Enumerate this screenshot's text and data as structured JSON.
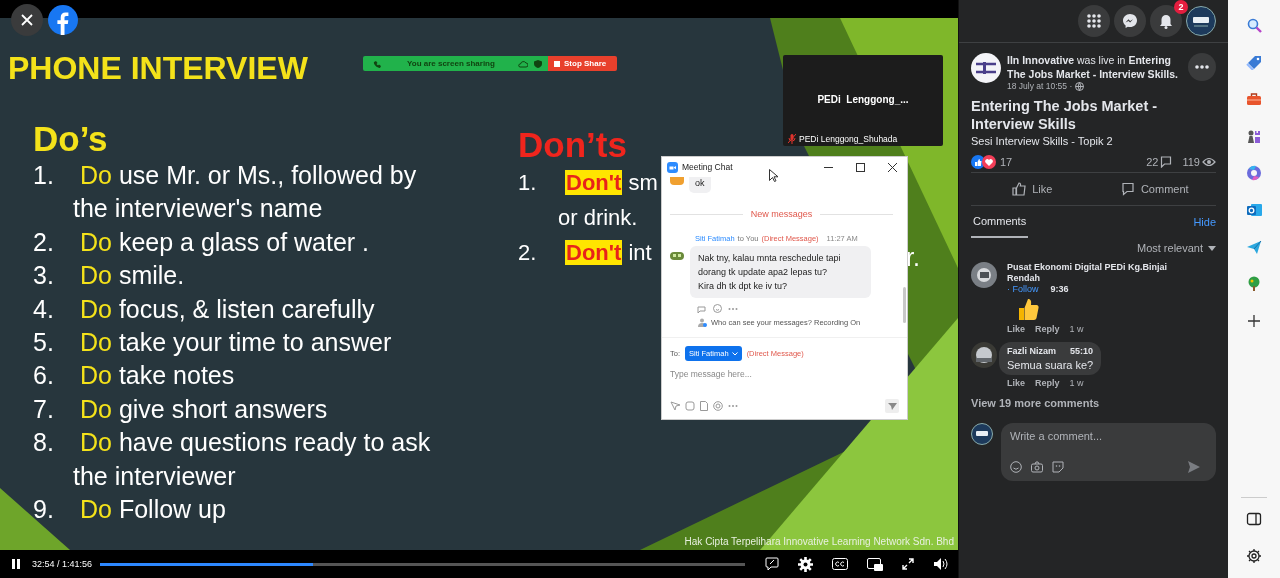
{
  "player": {
    "playing": true,
    "time": "32:54 / 1:41:56",
    "level": 0.33
  },
  "slide": {
    "title": "PHONE INTERVIEW",
    "dos": {
      "heading": "Do’s",
      "items": [
        {
          "number": "1.",
          "keyword": "Do",
          "lines": [
            "use Mr. or Ms., followed by",
            "the interviewer's name"
          ]
        },
        {
          "number": "2.",
          "keyword": "Do",
          "lines": [
            "keep a glass of water ."
          ]
        },
        {
          "number": "3.",
          "keyword": "Do",
          "lines": [
            "smile."
          ]
        },
        {
          "number": "4.",
          "keyword": "Do",
          "lines": [
            "focus, & listen carefully"
          ]
        },
        {
          "number": "5.",
          "keyword": "Do",
          "lines": [
            "take your time to answer"
          ]
        },
        {
          "number": "6.",
          "keyword": "Do",
          "lines": [
            "take notes"
          ]
        },
        {
          "number": "7.",
          "keyword": "Do",
          "lines": [
            "give short answers"
          ]
        },
        {
          "number": "8.",
          "keyword": "Do",
          "lines": [
            "have questions ready to ask",
            "the interviewer"
          ]
        },
        {
          "number": "9.",
          "keyword": "Do",
          "lines": [
            "Follow up"
          ]
        }
      ]
    },
    "donts": {
      "heading": "Don’ts",
      "items": [
        {
          "number": "1.",
          "keyword": "Don't",
          "lines": [
            "sm",
            "or drink."
          ]
        },
        {
          "number": "2.",
          "keyword": "Don't",
          "lines": [
            "int"
          ]
        }
      ],
      "fragment": "r."
    },
    "footer": "Hak Cipta Terpelihara Innovative Learning Network Sdn. Bhd"
  },
  "share_bar": {
    "status": "You are screen sharing",
    "stop_label": "Stop Share"
  },
  "participant": {
    "name": "PEDi  Lenggong_...",
    "label": "PEDi Lenggong_Shuhada",
    "muted": true
  },
  "chat": {
    "title": "Meeting Chat",
    "previous": "ok",
    "divider": "New messages",
    "message": {
      "sender": "Siti Fatimah",
      "to": "to You",
      "type": "(Direct Message)",
      "time": "11:27 AM",
      "lines": [
        "Nak tny, kalau mnta reschedule tapi",
        "dorang tk update apa2 lepas tu?",
        "Kira dh tk dpt ke iv tu?"
      ]
    },
    "notice": "Who can see your messages? Recording On",
    "to_label": "To:",
    "recipient": "Siti Fatimah",
    "recipient_note": "(Direct Message)",
    "input": {
      "placeholder": "Type message here..."
    }
  },
  "facebook": {
    "notifications": "2",
    "post": {
      "header": "**Iln Innovative** was live in **Entering The Jobs Market - Interview Skills.**",
      "date": "18 July at 10:55 ·",
      "title": "Entering The Jobs Market - Interview Skills",
      "subtitle": "Sesi Interview Skills - Topik 2",
      "reactions": "17",
      "comments": "22",
      "views": "119"
    },
    "actions": [
      "Like",
      "Comment"
    ],
    "tabs": [
      {
        "label": "Comments",
        "selected": true
      }
    ],
    "hide": "Hide",
    "sort": "Most relevant",
    "comments": [
      {
        "kind": "sticker",
        "name": "Pusat Ekonomi Digital PEDi Kg.Binjai Rendah",
        "follow": "· Follow",
        "time": "9:36",
        "actions": [
          "Like",
          "Reply"
        ],
        "age": "1 w"
      },
      {
        "kind": "text",
        "name": "Fazli Nizam",
        "time": "55:10",
        "text": "Semua suara ke?",
        "actions": [
          "Like",
          "Reply"
        ],
        "age": "1 w"
      }
    ],
    "view_more": "View 19 more comments",
    "composer": {
      "placeholder": "Write a comment..."
    }
  }
}
